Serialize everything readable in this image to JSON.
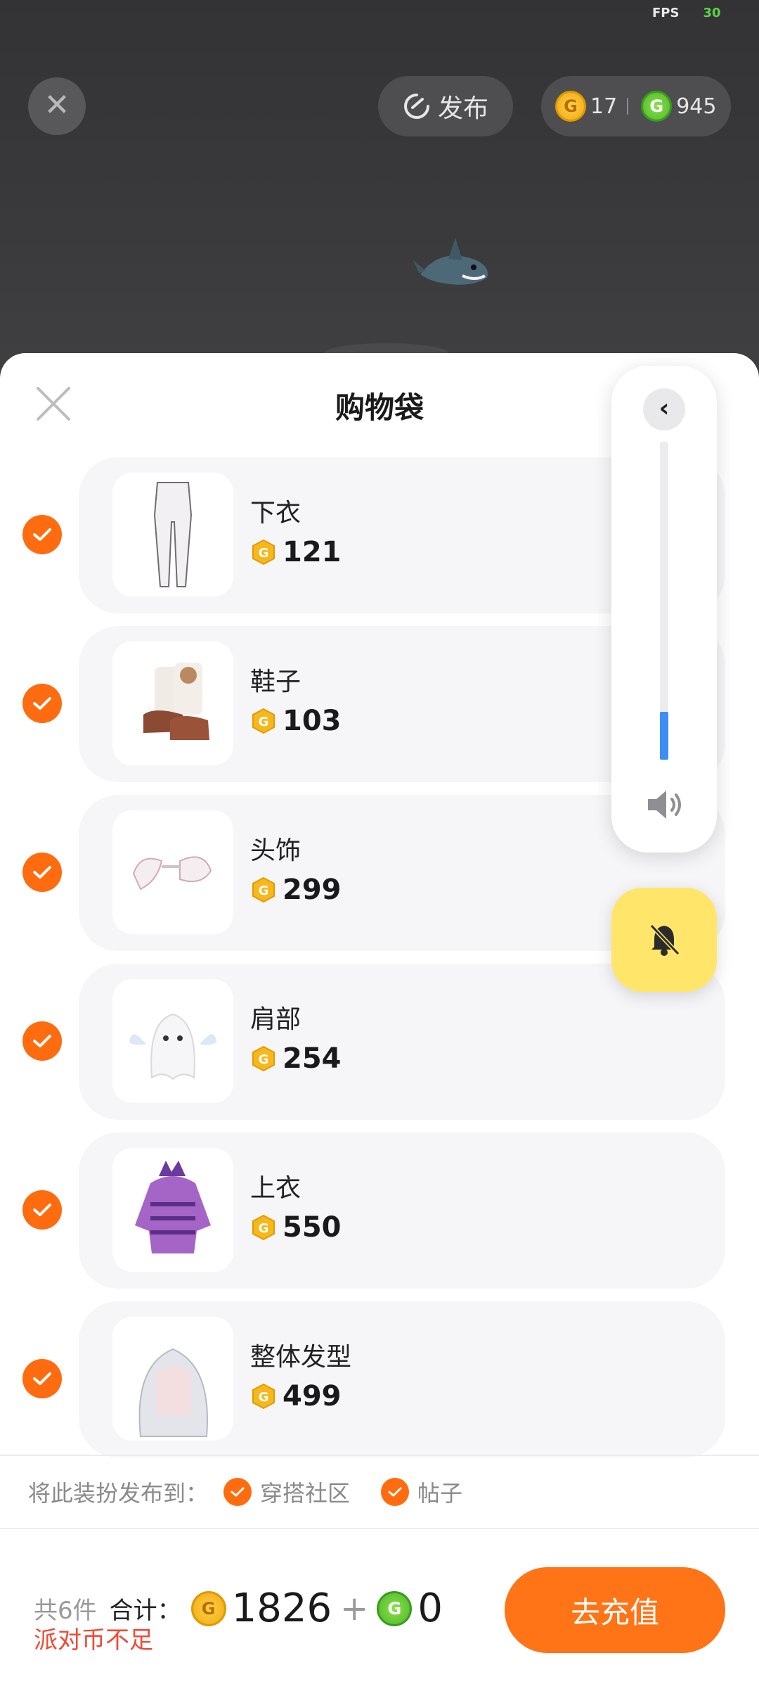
{
  "hud": {
    "fps_label": "FPS",
    "fps_value": "30"
  },
  "top_bar": {
    "close_icon": "close-icon",
    "publish_label": "发布",
    "gold_coin_count": "17",
    "green_coin_count": "945"
  },
  "sheet": {
    "title": "购物袋",
    "items": [
      {
        "name": "下衣",
        "price": "121",
        "checked": true
      },
      {
        "name": "鞋子",
        "price": "103",
        "checked": true
      },
      {
        "name": "头饰",
        "price": "299",
        "checked": true
      },
      {
        "name": "肩部",
        "price": "254",
        "checked": true
      },
      {
        "name": "上衣",
        "price": "550",
        "checked": true
      },
      {
        "name": "整体发型",
        "price": "499",
        "checked": true
      }
    ]
  },
  "volume_overlay": {
    "level": 0.15,
    "accent": "#3d8ef4"
  },
  "publish_to": {
    "label": "将此装扮发布到：",
    "options": [
      {
        "label": "穿搭社区",
        "checked": true
      },
      {
        "label": "帖子",
        "checked": true
      }
    ]
  },
  "footer": {
    "count": "共6件",
    "total_label": "合计：",
    "gold_total": "1826",
    "plus": "+",
    "green_total": "0",
    "warning": "派对币不足",
    "recharge_label": "去充值"
  },
  "colors": {
    "accent_orange": "#ff6b0f",
    "warning_red": "#f04a36",
    "mute_yellow": "#ffe66b"
  }
}
